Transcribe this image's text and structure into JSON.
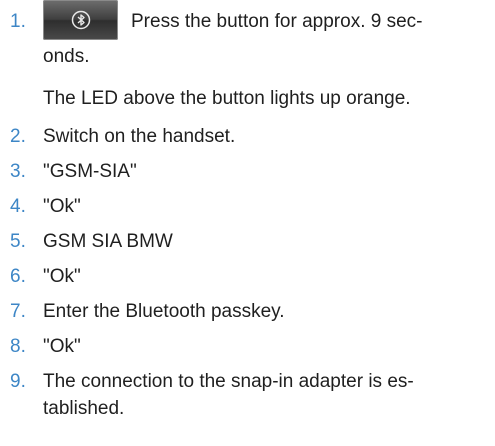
{
  "steps": [
    {
      "number": "1.",
      "lines": [
        "Press the button for approx. 9 sec-",
        "onds."
      ],
      "note": "The LED above the button lights up orange."
    },
    {
      "number": "2.",
      "lines": [
        "Switch on the handset."
      ]
    },
    {
      "number": "3.",
      "lines": [
        "\"GSM-SIA\""
      ]
    },
    {
      "number": "4.",
      "lines": [
        "\"Ok\""
      ]
    },
    {
      "number": "5.",
      "lines": [
        "GSM SIA BMW"
      ]
    },
    {
      "number": "6.",
      "lines": [
        "\"Ok\""
      ]
    },
    {
      "number": "7.",
      "lines": [
        "Enter the Bluetooth passkey."
      ]
    },
    {
      "number": "8.",
      "lines": [
        "\"Ok\""
      ]
    },
    {
      "number": "9.",
      "lines": [
        "The connection to the snap-in adapter is es-",
        "tablished."
      ]
    }
  ],
  "button_icon": "bluetooth-icon",
  "colors": {
    "step_number": "#3d86c6",
    "text": "#1f1f1f"
  }
}
